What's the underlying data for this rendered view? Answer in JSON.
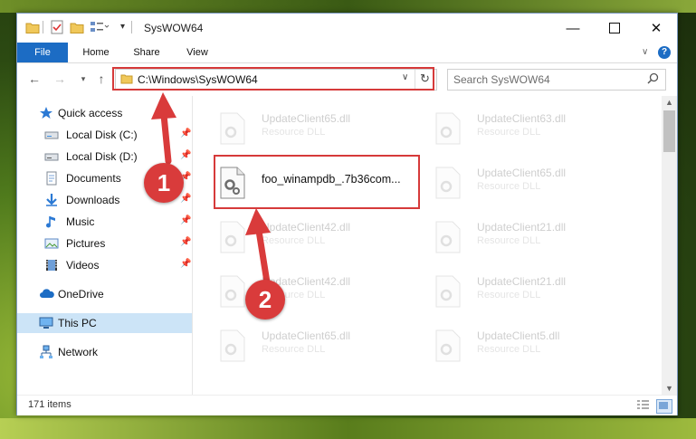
{
  "window": {
    "title": "SysWOW64"
  },
  "ribbon": {
    "tabs": [
      "File",
      "Home",
      "Share",
      "View"
    ]
  },
  "address_bar": {
    "path": "C:\\Windows\\SysWOW64"
  },
  "search": {
    "placeholder": "Search SysWOW64"
  },
  "sidebar": {
    "items": [
      {
        "label": "Quick access",
        "icon": "star-icon",
        "pinned": false
      },
      {
        "label": "Local Disk (C:)",
        "icon": "drive-icon",
        "pinned": true
      },
      {
        "label": "Local Disk (D:)",
        "icon": "drive-icon",
        "pinned": true
      },
      {
        "label": "Documents",
        "icon": "documents-icon",
        "pinned": true
      },
      {
        "label": "Downloads",
        "icon": "download-icon",
        "pinned": true
      },
      {
        "label": "Music",
        "icon": "music-icon",
        "pinned": true
      },
      {
        "label": "Pictures",
        "icon": "pictures-icon",
        "pinned": true
      },
      {
        "label": "Videos",
        "icon": "video-icon",
        "pinned": true
      },
      {
        "label": "OneDrive",
        "icon": "cloud-icon",
        "pinned": false
      },
      {
        "label": "This PC",
        "icon": "computer-icon",
        "pinned": false,
        "selected": true
      },
      {
        "label": "Network",
        "icon": "network-icon",
        "pinned": false
      }
    ]
  },
  "files": [
    {
      "name": "UpdateClient65.dll",
      "type": "Resource DLL"
    },
    {
      "name": "UpdateClient63.dll",
      "type": "Resource DLL"
    },
    {
      "name": "foo_winampdb_.7b36com...",
      "type": ""
    },
    {
      "name": "UpdateClient65.dll",
      "type": "Resource DLL"
    },
    {
      "name": "UpdateClient42.dll",
      "type": "Resource DLL"
    },
    {
      "name": "UpdateClient21.dll",
      "type": "Resource DLL"
    },
    {
      "name": "UpdateClient42.dll",
      "type": "Resource DLL"
    },
    {
      "name": "UpdateClient21.dll",
      "type": "Resource DLL"
    },
    {
      "name": "UpdateClient65.dll",
      "type": "Resource DLL"
    },
    {
      "name": "UpdateClient5.dll",
      "type": "Resource DLL"
    }
  ],
  "status": {
    "item_count": "171 items"
  },
  "annotations": {
    "step1": "1",
    "step2": "2",
    "highlight_color": "#d63a3a"
  },
  "colors": {
    "file_tab": "#1c6cc4",
    "selected_nav": "#cce4f7"
  }
}
